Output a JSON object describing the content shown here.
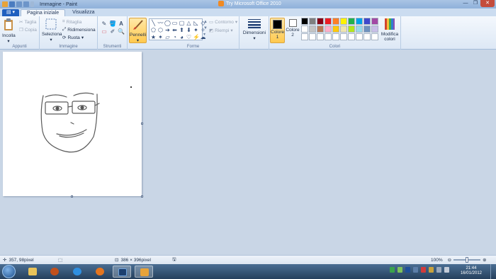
{
  "window": {
    "document_title": "Immagine - Paint",
    "promo_text": "Try Microsoft Office 2010",
    "controls": [
      "—",
      "❐",
      "✕"
    ]
  },
  "tabs": {
    "app_menu": "▤ ▾",
    "items": [
      {
        "label": "Pagina iniziale",
        "active": true
      },
      {
        "label": "Visualizza",
        "active": false
      }
    ]
  },
  "ribbon": {
    "appunti": {
      "label": "Appunti",
      "paste": "Incolla",
      "cut": "Taglia",
      "copy": "Copia"
    },
    "immagine": {
      "label": "Immagine",
      "select": "Seleziona",
      "crop": "Ritaglia",
      "resize": "Ridimensiona",
      "rotate": "Ruota"
    },
    "strumenti": {
      "label": "Strumenti",
      "tools": [
        "✎",
        "🪣",
        "A",
        "▭",
        "✐",
        "🔍"
      ]
    },
    "pennelli": {
      "label": "Pennelli"
    },
    "forme": {
      "label": "Forme",
      "shapes": [
        "╲",
        "〰",
        "◯",
        "▭",
        "▢",
        "△",
        "◺",
        "◇",
        "⬠",
        "⬡",
        "➔",
        "⬅",
        "⬆",
        "⬇",
        "✦",
        "✧",
        "★",
        "✶",
        "▱",
        "◔",
        "◕",
        "♡",
        "⚡",
        "☁"
      ],
      "outline": "Contorno",
      "fill": "Riempi"
    },
    "dimensioni": {
      "label": "Dimensioni"
    },
    "colori": {
      "label": "Colori",
      "color1_label": "Colore",
      "color1_num": "1",
      "color2_label": "Colore",
      "color2_num": "2",
      "color1_value": "#000000",
      "color2_value": "#ffffff",
      "edit": "Modifica colori",
      "palette": [
        "#000000",
        "#7f7f7f",
        "#880015",
        "#ed1c24",
        "#ff7f27",
        "#fff200",
        "#22b14c",
        "#00a2e8",
        "#3f48cc",
        "#a349a4",
        "#ffffff",
        "#c3c3c3",
        "#b97a57",
        "#ffaec9",
        "#ffc90e",
        "#efe4b0",
        "#b5e61d",
        "#99d9ea",
        "#7092be",
        "#c8bfe7",
        "#ffffff",
        "#ffffff",
        "#ffffff",
        "#ffffff",
        "#ffffff",
        "#ffffff",
        "#ffffff",
        "#ffffff",
        "#ffffff",
        "#ffffff"
      ]
    }
  },
  "status": {
    "cursor_pos": "357, 98pixel",
    "image_size": "386 × 396pixel",
    "zoom": "100%"
  },
  "taskbar": {
    "time": "21:44",
    "date": "16/01/2012"
  }
}
